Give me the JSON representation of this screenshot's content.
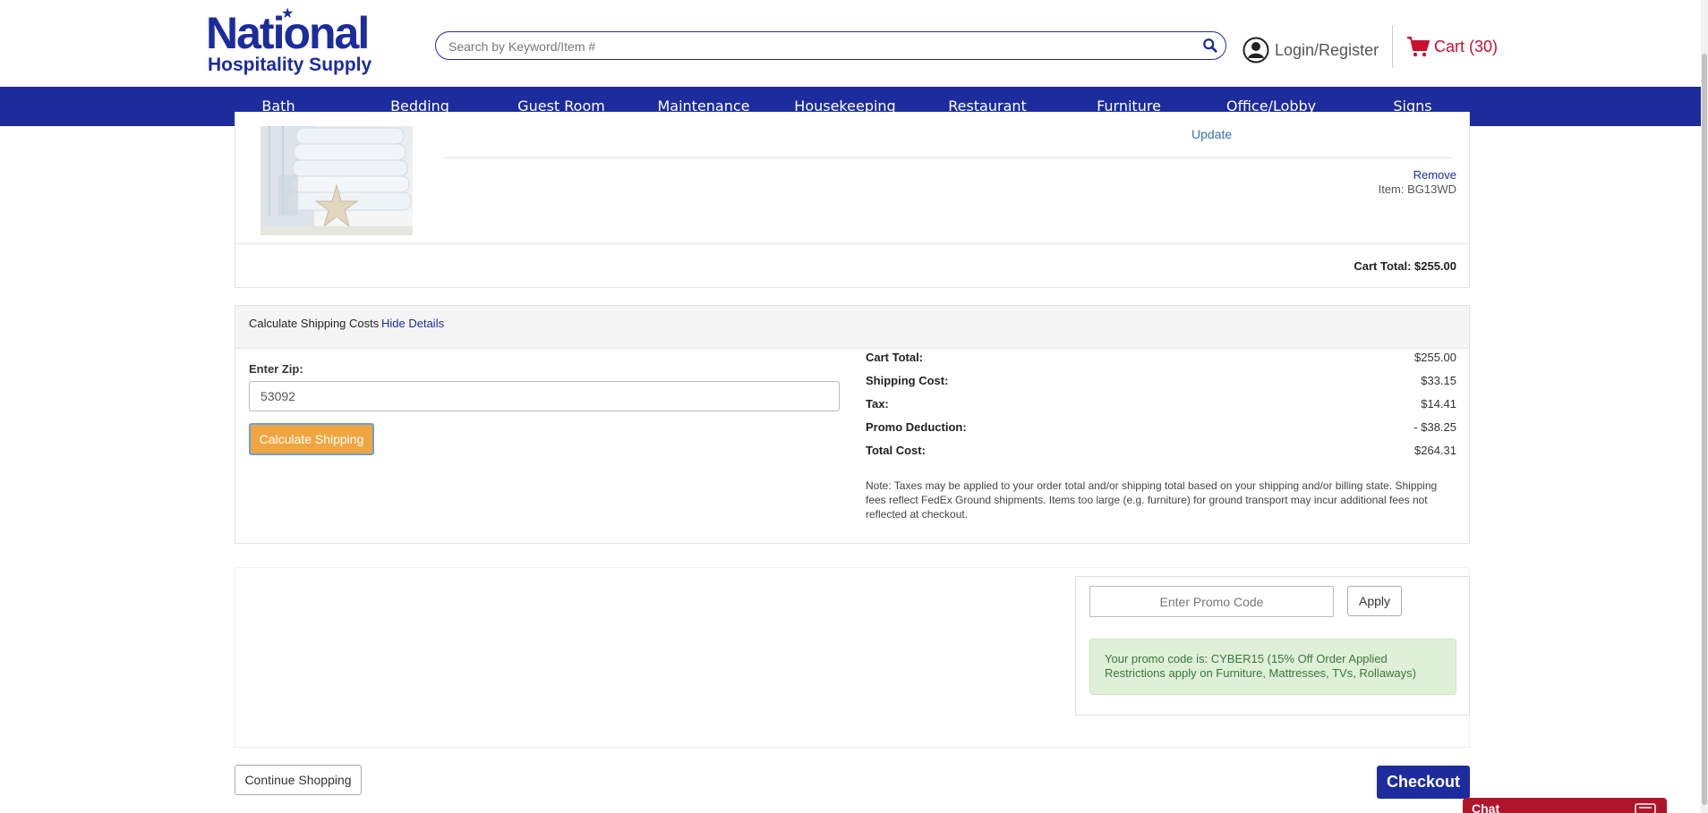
{
  "header": {
    "logo_line1": "National",
    "logo_line2": "Hospitality Supply",
    "search_placeholder": "Search by Keyword/Item #",
    "login_label": "Login/Register",
    "cart_label": "Cart (30)",
    "icons": [
      "search-icon",
      "user-icon",
      "cart-icon"
    ]
  },
  "nav": {
    "items": [
      "Bath",
      "Bedding",
      "Guest Room",
      "Maintenance",
      "Housekeeping",
      "Restaurant",
      "Furniture",
      "Office/Lobby",
      "Signs"
    ]
  },
  "cart_item": {
    "update_label": "Update",
    "remove_label": "Remove",
    "item_code": "Item: BG13WD"
  },
  "cart_total": "Cart Total: $255.00",
  "shipping": {
    "title": "Calculate Shipping Costs",
    "hide_details": "Hide Details",
    "zip_label": "Enter Zip:",
    "zip_value": "53092",
    "calc_button": "Calculate Shipping",
    "rows": [
      {
        "label": "Cart Total:",
        "value": "$255.00"
      },
      {
        "label": "Shipping Cost:",
        "value": "$33.15"
      },
      {
        "label": "Tax:",
        "value": "$14.41"
      },
      {
        "label": "Promo Deduction:",
        "value": "- $38.25"
      },
      {
        "label": "Total Cost:",
        "value": "$264.31"
      }
    ],
    "note": "Note: Taxes may be applied to your order total and/or shipping total based on your shipping and/or billing state. Shipping fees reflect FedEx Ground shipments. Items too large (e.g. furniture) for ground transport may incur additional fees not reflected at checkout."
  },
  "promo": {
    "placeholder": "Enter Promo Code",
    "apply_label": "Apply",
    "message_line1": "Your promo code is: CYBER15 (15% Off Order Applied",
    "message_line2": "Restrictions apply on Furniture, Mattresses, TVs, Rollaways)"
  },
  "footer": {
    "continue_label": "Continue Shopping",
    "checkout_label": "Checkout",
    "chat_label": "Chat"
  },
  "colors": {
    "brand_blue": "#1c2c9c",
    "cart_red": "#c8102e",
    "calc_orange": "#f0a640",
    "promo_green_bg": "#dff0d8",
    "chat_red": "#b0142a"
  }
}
